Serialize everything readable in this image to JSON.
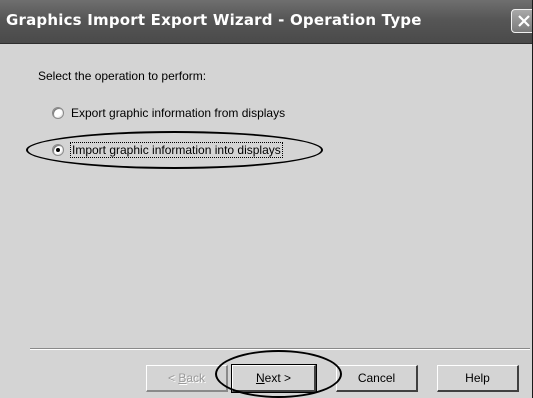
{
  "window": {
    "title": "Graphics Import Export Wizard - Operation Type"
  },
  "content": {
    "prompt": "Select the operation to perform:",
    "options": [
      {
        "label": "Export graphic information from displays",
        "selected": false
      },
      {
        "label": "Import graphic information into displays",
        "selected": true
      }
    ]
  },
  "buttons": {
    "back": {
      "accel": "B",
      "rest": "ack",
      "prefix": "< ",
      "enabled": false
    },
    "next": {
      "accel": "N",
      "rest": "ext >"
    },
    "cancel": "Cancel",
    "help": "Help"
  },
  "icons": {
    "close": "close-icon"
  },
  "colors": {
    "titlebar": "#565656",
    "dialog_background": "#d4d4d4"
  }
}
